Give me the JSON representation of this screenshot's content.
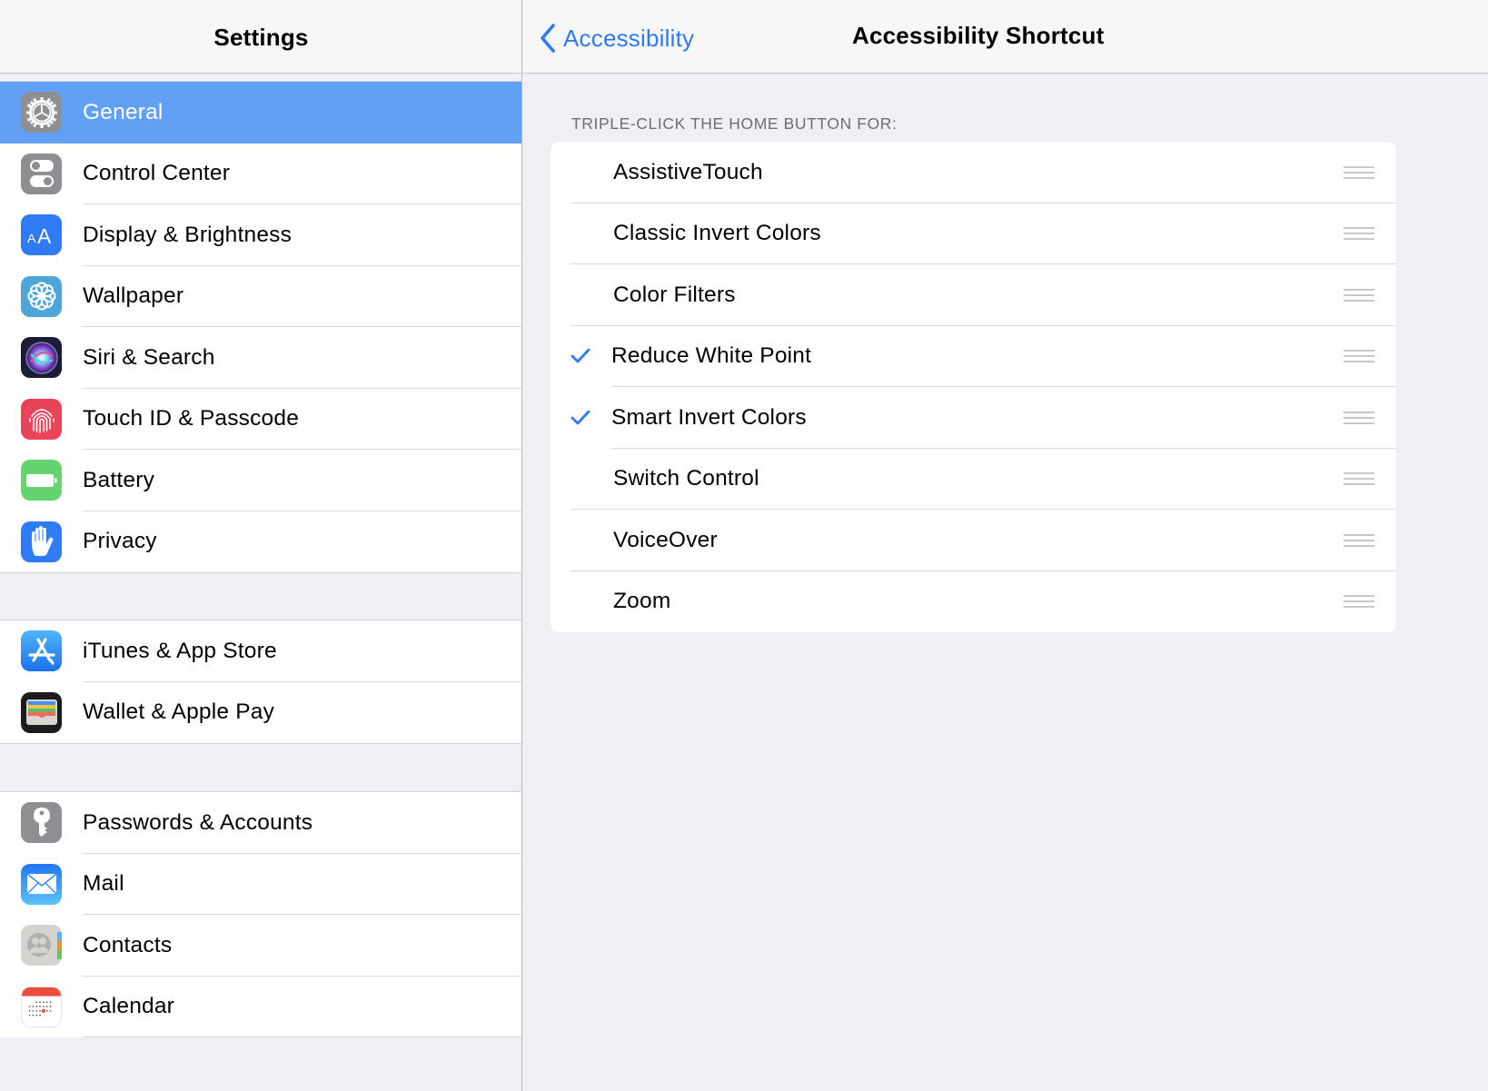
{
  "master": {
    "title": "Settings",
    "groups": [
      {
        "items": [
          {
            "label": "General",
            "icon": "gear-icon",
            "icon_bg": "#8e8e93",
            "selected": true
          },
          {
            "label": "Control Center",
            "icon": "toggles-icon",
            "icon_bg": "#8e8e93"
          },
          {
            "label": "Display & Brightness",
            "icon": "text-size-icon",
            "icon_bg": "#2f7af5"
          },
          {
            "label": "Wallpaper",
            "icon": "flower-icon",
            "icon_bg": "#4ea6d8"
          },
          {
            "label": "Siri & Search",
            "icon": "siri-icon",
            "icon_bg": "#1b1b3a"
          },
          {
            "label": "Touch ID & Passcode",
            "icon": "fingerprint-icon",
            "icon_bg": "#e9435a"
          },
          {
            "label": "Battery",
            "icon": "battery-icon",
            "icon_bg": "#65d36e"
          },
          {
            "label": "Privacy",
            "icon": "hand-icon",
            "icon_bg": "#2f7af5"
          }
        ]
      },
      {
        "items": [
          {
            "label": "iTunes & App Store",
            "icon": "app-store-icon",
            "icon_bg": "#2f8cf5"
          },
          {
            "label": "Wallet & Apple Pay",
            "icon": "wallet-icon",
            "icon_bg": "#1c1c1e"
          }
        ]
      },
      {
        "items": [
          {
            "label": "Passwords & Accounts",
            "icon": "key-icon",
            "icon_bg": "#8e8e93"
          },
          {
            "label": "Mail",
            "icon": "mail-icon",
            "icon_bg": "#2f82f5"
          },
          {
            "label": "Contacts",
            "icon": "contacts-icon",
            "icon_bg": "#d5d3cf"
          },
          {
            "label": "Calendar",
            "icon": "calendar-icon",
            "icon_bg": "#ffffff"
          }
        ]
      }
    ]
  },
  "detail": {
    "back_label": "Accessibility",
    "title": "Accessibility Shortcut",
    "section_header": "TRIPLE-CLICK THE HOME BUTTON FOR:",
    "options": [
      {
        "label": "AssistiveTouch",
        "checked": false
      },
      {
        "label": "Classic Invert Colors",
        "checked": false
      },
      {
        "label": "Color Filters",
        "checked": false
      },
      {
        "label": "Reduce White Point",
        "checked": true
      },
      {
        "label": "Smart Invert Colors",
        "checked": true
      },
      {
        "label": "Switch Control",
        "checked": false
      },
      {
        "label": "VoiceOver",
        "checked": false
      },
      {
        "label": "Zoom",
        "checked": false
      }
    ]
  },
  "colors": {
    "accent": "#2f7af5",
    "selection": "#62a0f5",
    "background": "#efeff4",
    "separator": "#d9d9dc",
    "secondary_text": "#6d6d72"
  }
}
